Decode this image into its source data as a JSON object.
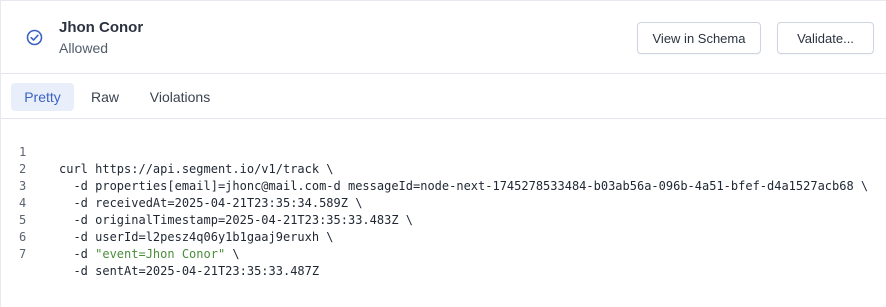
{
  "header": {
    "title": "Jhon Conor",
    "status": "Allowed",
    "buttons": {
      "view_schema": "View in Schema",
      "validate": "Validate..."
    },
    "status_icon": "check-circle-icon",
    "accent_color": "#3a63c4"
  },
  "tabs": [
    {
      "label": "Pretty",
      "active": true
    },
    {
      "label": "Raw",
      "active": false
    },
    {
      "label": "Violations",
      "active": false
    }
  ],
  "code": {
    "lines": [
      {
        "num": "1",
        "text": "curl https://api.segment.io/v1/track \\"
      },
      {
        "num": "2",
        "text": "  -d properties[email]=jhonc@mail.com-d messageId=node-next-1745278533484-b03ab56a-096b-4a51-bfef-d4a1527acb68 \\"
      },
      {
        "num": "3",
        "text": "  -d receivedAt=2025-04-21T23:35:34.589Z \\"
      },
      {
        "num": "4",
        "text": "  -d originalTimestamp=2025-04-21T23:35:33.483Z \\"
      },
      {
        "num": "5",
        "text": "  -d userId=l2pesz4q06y1b1gaaj9eruxh \\"
      },
      {
        "num": "6",
        "pre": "  -d ",
        "str": "\"event=Jhon Conor\"",
        "post": " \\"
      },
      {
        "num": "7",
        "text": "  -d sentAt=2025-04-21T23:35:33.487Z"
      }
    ],
    "string_color": "#4a8d3c"
  }
}
